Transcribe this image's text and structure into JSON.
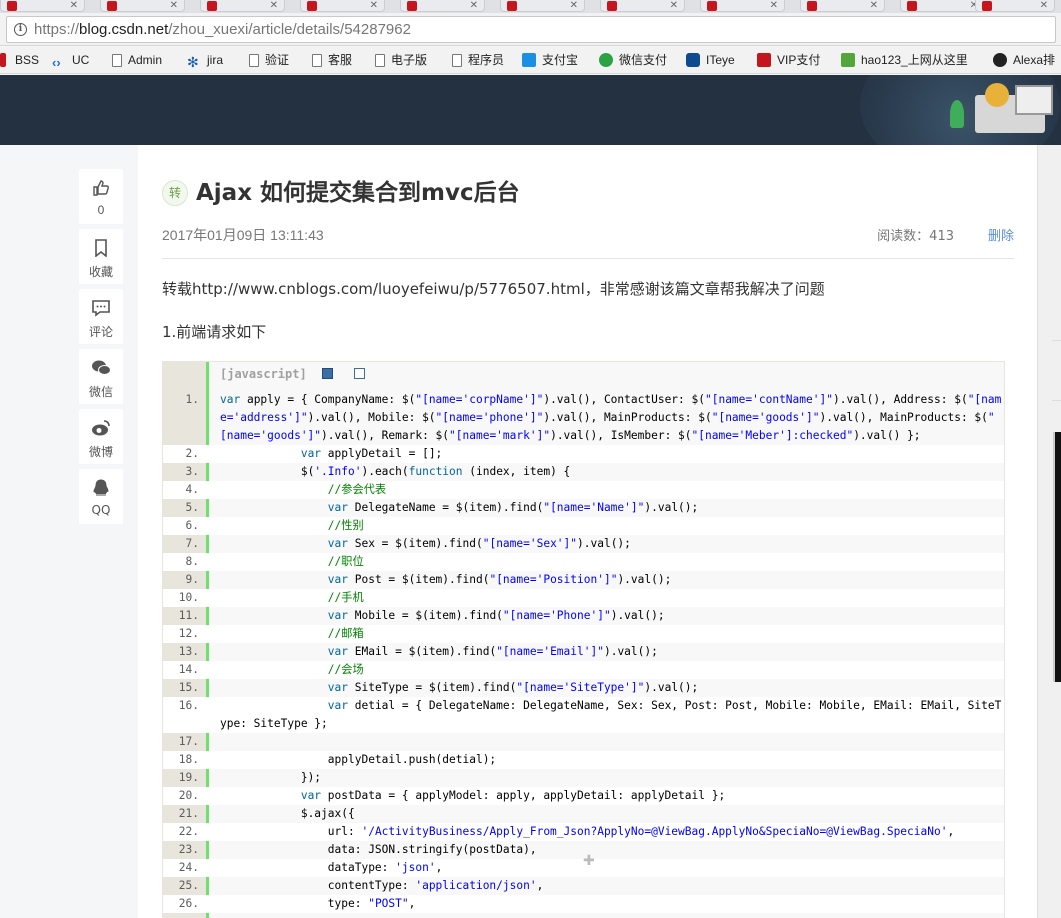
{
  "browser": {
    "url_scheme": "https://",
    "url_host": "blog.csdn.net",
    "url_path": "/zhou_xuexi/article/details/54287962",
    "info_icon": "i"
  },
  "bookmarks": [
    {
      "label": "BSS",
      "icon": "red-square-icon"
    },
    {
      "label": "UC",
      "icon": "chevron-icon"
    },
    {
      "label": "Admin",
      "icon": "page-icon"
    },
    {
      "label": "jira",
      "icon": "jira-icon"
    },
    {
      "label": "验证",
      "icon": "page-icon"
    },
    {
      "label": "客服",
      "icon": "page-icon"
    },
    {
      "label": "电子版",
      "icon": "page-icon"
    },
    {
      "label": "程序员",
      "icon": "page-icon"
    },
    {
      "label": "支付宝",
      "icon": "alipay-icon"
    },
    {
      "label": "微信支付",
      "icon": "wechat-icon"
    },
    {
      "label": "ITeye",
      "icon": "iteye-icon"
    },
    {
      "label": "VIP支付",
      "icon": "red-c-icon"
    },
    {
      "label": "hao123_上网从这里",
      "icon": "hao123-icon"
    },
    {
      "label": "Alexa排",
      "icon": "alexa-icon"
    }
  ],
  "toolbar": {
    "like_count": "0",
    "collect_label": "收藏",
    "comment_label": "评论",
    "wechat_label": "微信",
    "weibo_label": "微博",
    "qq_label": "QQ"
  },
  "article": {
    "badge": "转",
    "title": "Ajax 如何提交集合到mvc后台",
    "date": "2017年01月09日 13:11:43",
    "views": "阅读数：413",
    "delete_label": "删除",
    "para1": "转载http://www.cnblogs.com/luoyefeiwu/p/5776507.html，非常感谢该篇文章帮我解决了问题",
    "para2": "1.前端请求如下",
    "code_lang": "[javascript]"
  },
  "code_lines": [
    {
      "n": "1.",
      "html": "<span class=\"kw\">var</span> apply = { CompanyName: $(<span class=\"str\">\"[name='corpName']\"</span>).val(), ContactUser: $(<span class=\"str\">\"[name='contName']\"</span>).val(), Address: $(<span class=\"str\">\"[name='address']\"</span>).val(), Mobile: $(<span class=\"str\">\"[name='phone']\"</span>).val(), MainProducts: $(<span class=\"str\">\"[name='goods']\"</span>).val(), MainProducts: $(<span class=\"str\">\"[name='goods']\"</span>).val(), Remark: $(<span class=\"str\">\"[name='mark']\"</span>).val(), IsMember: $(<span class=\"str\">\"[name='Meber']:checked\"</span>).val() };"
    },
    {
      "n": "2.",
      "html": "            <span class=\"kw\">var</span> applyDetail = [];"
    },
    {
      "n": "3.",
      "html": "            $(<span class=\"str\">'.Info'</span>).each(<span class=\"kw\">function</span> (index, item) {"
    },
    {
      "n": "4.",
      "html": "                <span class=\"cm\">//参会代表</span>"
    },
    {
      "n": "5.",
      "html": "                <span class=\"kw\">var</span> DelegateName = $(item).find(<span class=\"str\">\"[name='Name']\"</span>).val();"
    },
    {
      "n": "6.",
      "html": "                <span class=\"cm\">//性别</span>"
    },
    {
      "n": "7.",
      "html": "                <span class=\"kw\">var</span> Sex = $(item).find(<span class=\"str\">\"[name='Sex']\"</span>).val();"
    },
    {
      "n": "8.",
      "html": "                <span class=\"cm\">//职位</span>"
    },
    {
      "n": "9.",
      "html": "                <span class=\"kw\">var</span> Post = $(item).find(<span class=\"str\">\"[name='Position']\"</span>).val();"
    },
    {
      "n": "10.",
      "html": "                <span class=\"cm\">//手机</span>"
    },
    {
      "n": "11.",
      "html": "                <span class=\"kw\">var</span> Mobile = $(item).find(<span class=\"str\">\"[name='Phone']\"</span>).val();"
    },
    {
      "n": "12.",
      "html": "                <span class=\"cm\">//邮箱</span>"
    },
    {
      "n": "13.",
      "html": "                <span class=\"kw\">var</span> EMail = $(item).find(<span class=\"str\">\"[name='Email']\"</span>).val();"
    },
    {
      "n": "14.",
      "html": "                <span class=\"cm\">//会场</span>"
    },
    {
      "n": "15.",
      "html": "                <span class=\"kw\">var</span> SiteType = $(item).find(<span class=\"str\">\"[name='SiteType']\"</span>).val();"
    },
    {
      "n": "16.",
      "html": "                <span class=\"kw\">var</span> detial = { DelegateName: DelegateName, Sex: Sex, Post: Post, Mobile: Mobile, EMail: EMail, SiteType: SiteType };"
    },
    {
      "n": "17.",
      "html": ""
    },
    {
      "n": "18.",
      "html": "                applyDetail.push(detial);"
    },
    {
      "n": "19.",
      "html": "            });"
    },
    {
      "n": "20.",
      "html": "            <span class=\"kw\">var</span> postData = { applyModel: apply, applyDetail: applyDetail };"
    },
    {
      "n": "21.",
      "html": "            $.ajax({"
    },
    {
      "n": "22.",
      "html": "                url: <span class=\"str\">'/ActivityBusiness/Apply_From_Json?ApplyNo=@ViewBag.ApplyNo&amp;SpeciaNo=@ViewBag.SpeciaNo'</span>,"
    },
    {
      "n": "23.",
      "html": "                data: JSON.stringify(postData),"
    },
    {
      "n": "24.",
      "html": "                dataType: <span class=\"str\">'json'</span>,"
    },
    {
      "n": "25.",
      "html": "                contentType: <span class=\"str\">'application/json'</span>,"
    },
    {
      "n": "26.",
      "html": "                type: <span class=\"str\">\"POST\"</span>,"
    }
  ]
}
